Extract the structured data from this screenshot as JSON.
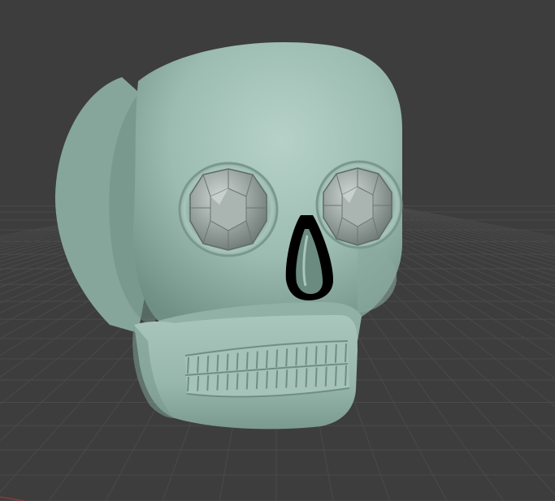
{
  "viewport": {
    "background_color": "#3d3d3d",
    "grid_color": "#4a4a4a",
    "x_axis_color": "#8a3a3a",
    "grid_visible": true
  },
  "model": {
    "name": "skull",
    "material_color": "#9cbcb1",
    "shadow_color": "#5f7d73",
    "highlight_color": "#c4ddd4",
    "gem_color": "#8f9a96",
    "gem_highlight": "#c9d2cf"
  }
}
